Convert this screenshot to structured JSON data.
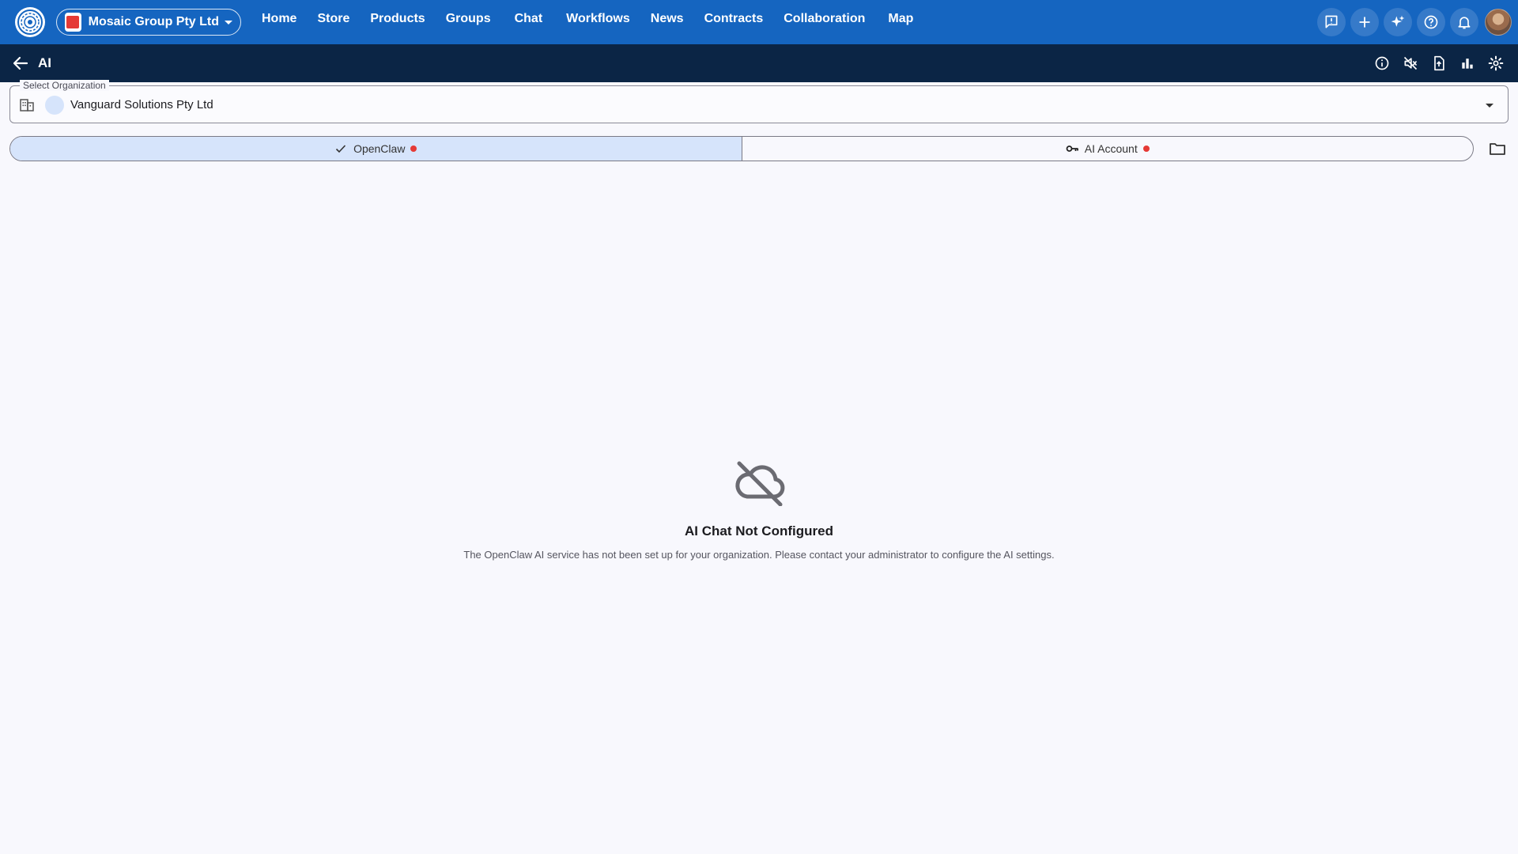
{
  "topbar": {
    "org_name": "Mosaic Group Pty Ltd",
    "nav": [
      "Home",
      "Store",
      "Products",
      "Groups",
      "Chat",
      "Workflows",
      "News",
      "Contracts",
      "Collaboration",
      "Map"
    ],
    "actions": [
      "feedback-icon",
      "add-icon",
      "sparkle-icon",
      "help-icon",
      "bell-icon"
    ],
    "brand_color": "#1565c0"
  },
  "subbar": {
    "title": "AI",
    "actions": [
      "info-icon",
      "mute-icon",
      "file-export-icon",
      "bar-chart-icon",
      "settings-icon"
    ],
    "color": "#0b2545"
  },
  "org_select": {
    "label": "Select Organization",
    "value": "Vanguard Solutions Pty Ltd"
  },
  "tabs": [
    {
      "label": "OpenClaw",
      "icon": "check-icon",
      "active": true
    },
    {
      "label": "AI Account",
      "icon": "key-icon",
      "active": false
    }
  ],
  "empty_state": {
    "icon": "cloud-off-icon",
    "title": "AI Chat Not Configured",
    "message": "The OpenClaw AI service has not been set up for your organization. Please contact your administrator to configure the AI settings."
  }
}
